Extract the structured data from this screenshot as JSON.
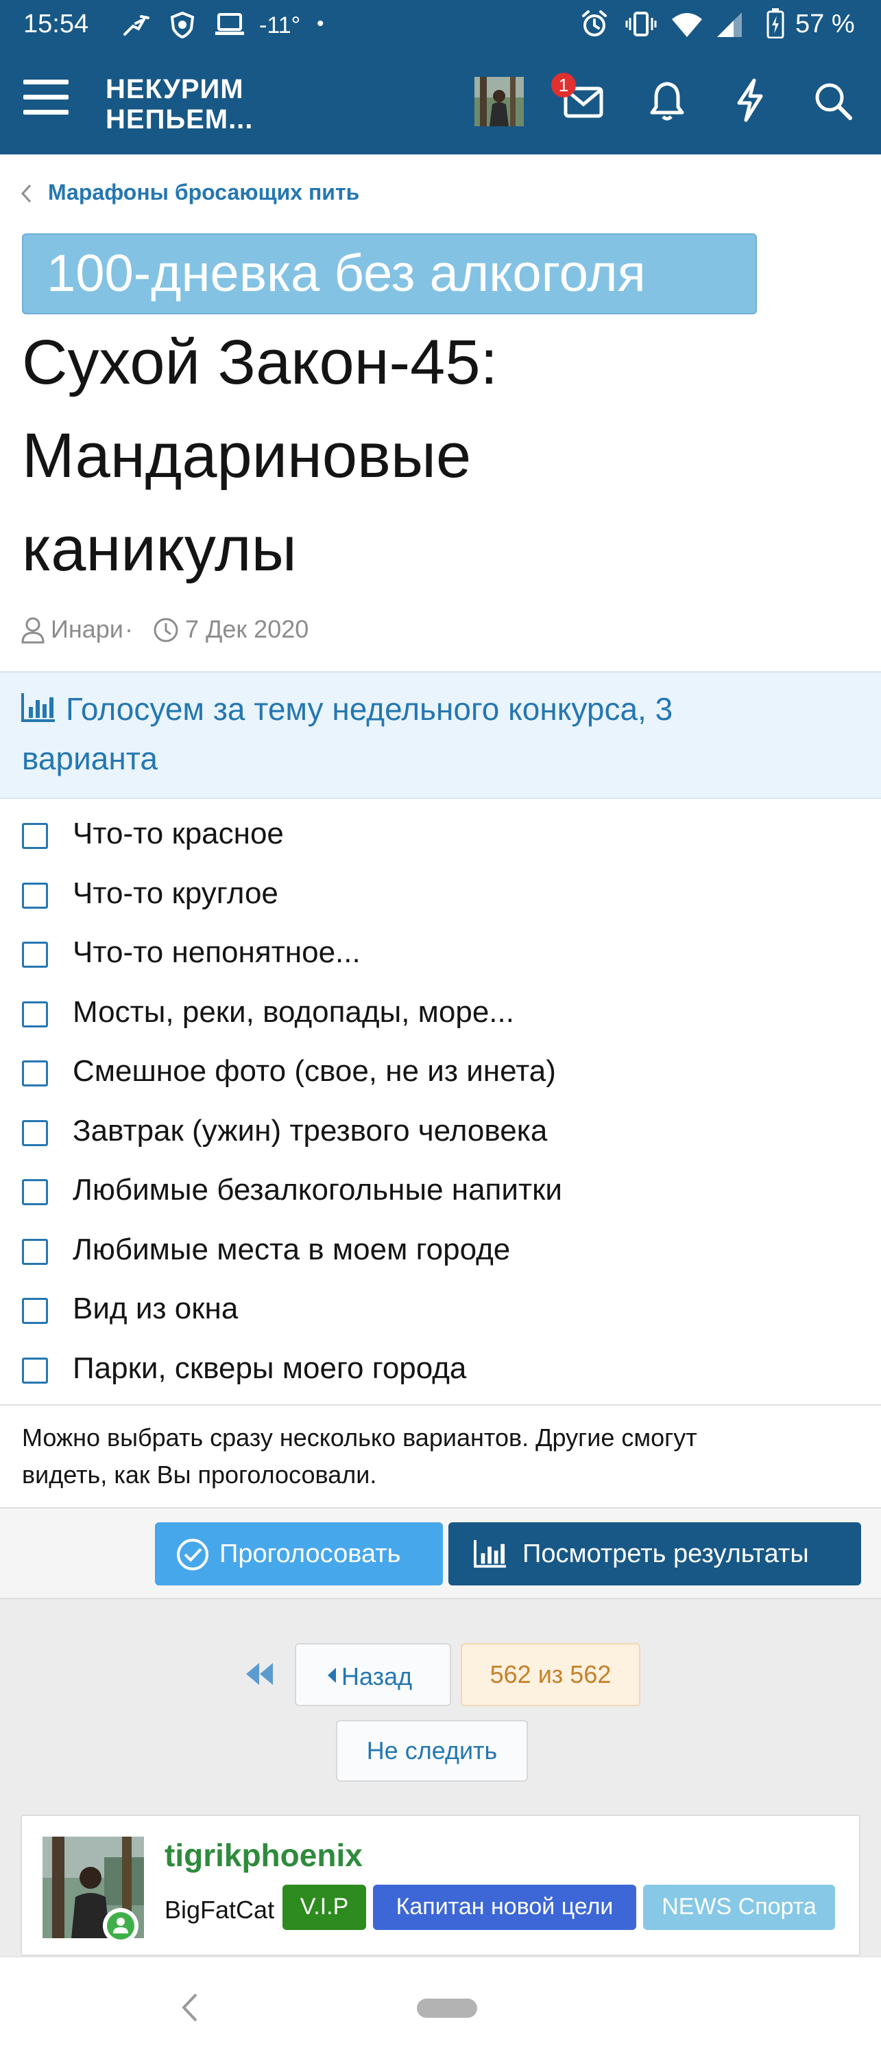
{
  "status_bar": {
    "time": "15:54",
    "temperature": "-11°",
    "dot": "•",
    "battery": "57 %",
    "icons": [
      "runner-icon",
      "shield-app-icon",
      "laptop-icon",
      "alarm-icon",
      "vibrate-icon",
      "wifi-icon",
      "signal-icon",
      "battery-charging-icon"
    ]
  },
  "header": {
    "logo_line1": "НЕКУРИМ",
    "logo_line2": "НЕПЬЕМ...",
    "inbox_badge": "1",
    "icons": [
      "menu-icon",
      "avatar",
      "mail-icon",
      "bell-icon",
      "lightning-icon",
      "search-icon"
    ]
  },
  "breadcrumb": {
    "label": "Марафоны бросающих пить"
  },
  "thread": {
    "prefix": "100-дневка без алкоголя",
    "title_lines": [
      "Сухой Закон-45:",
      "Мандариновые",
      "каникулы"
    ],
    "author": "Инари",
    "separator": "·",
    "date": "7 Дек 2020"
  },
  "poll": {
    "question_line1": "Голосуем за тему недельного конкурса, 3",
    "question_line2": "варианта",
    "options": [
      "Что-то красное",
      "Что-то круглое",
      "Что-то непонятное...",
      "Мосты, реки, водопады, море...",
      "Смешное фото (свое, не из инета)",
      "Завтрак (ужин) трезвого человека",
      "Любимые безалкогольные напитки",
      "Любимые места в моем городе",
      "Вид из окна",
      "Парки, скверы моего города"
    ],
    "hint_line1": "Можно выбрать сразу несколько вариантов. Другие смогут",
    "hint_line2": "видеть, как Вы проголосовали.",
    "vote_label": "Проголосовать",
    "results_label": "Посмотреть результаты"
  },
  "pagination": {
    "back_label": "Назад",
    "current": "562 из 562",
    "unwatch_label": "Не следить"
  },
  "post": {
    "username": "tigrikphoenix",
    "user_title": "BigFatCat",
    "banners": [
      {
        "label": "V.I.P",
        "color": "#2e8b1f"
      },
      {
        "label": "Капитан новой цели",
        "color": "#3d67d6"
      },
      {
        "label": "NEWS Спорта",
        "color": "#86c8e6"
      }
    ]
  },
  "colors": {
    "header": "#185886",
    "link": "#2577b1",
    "accent": "#47a7eb"
  }
}
